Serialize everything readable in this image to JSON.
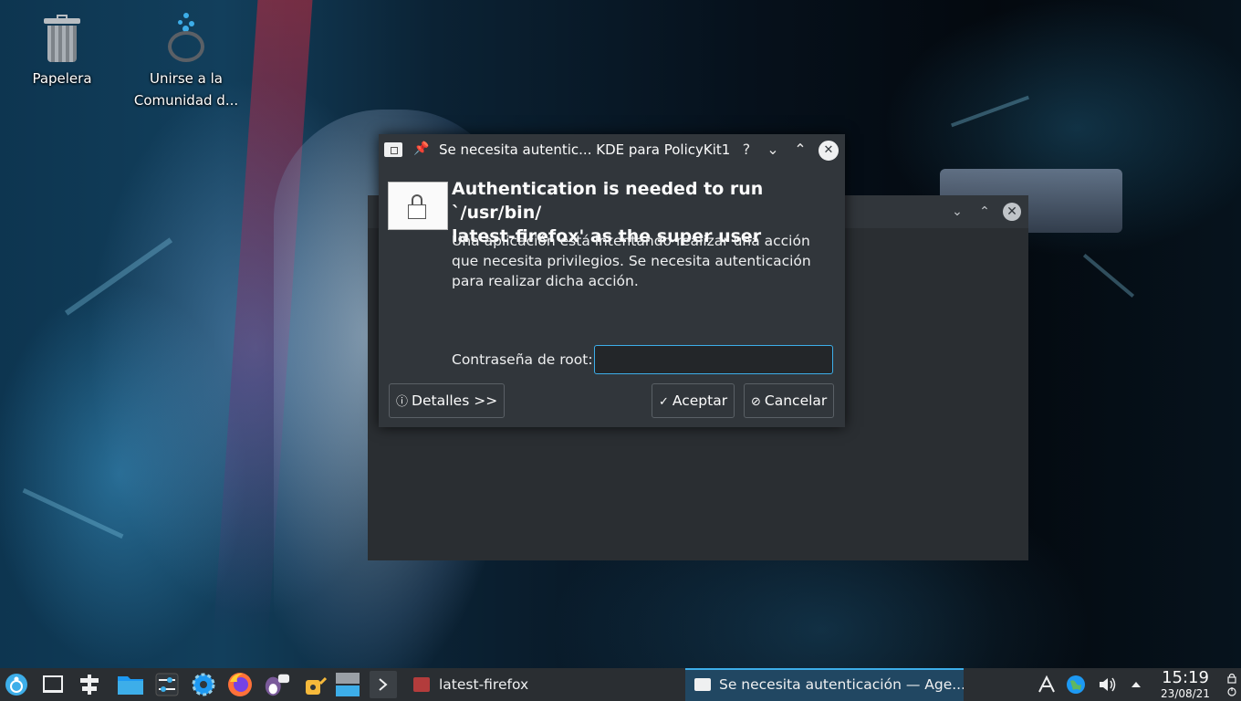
{
  "desktop": {
    "icons": [
      {
        "label": "Papelera",
        "icon": "trash-icon"
      },
      {
        "label": "Unirse a la Comunidad d...",
        "icon": "community-icon"
      }
    ]
  },
  "background_window": {
    "controls": [
      "minimize",
      "maximize",
      "close"
    ]
  },
  "dialog": {
    "title": "Se necesita autentic... KDE para PolicyKit1",
    "heading": "Authentication is needed to run `/usr/bin/latest-firefox' as the super user",
    "heading_line1": "Authentication is needed to run `/usr/bin/",
    "heading_line2": "latest-firefox' as the super user",
    "description": "Una aplicación está intentando realizar una acción que necesita privilegios. Se necesita autenticación para realizar dicha acción.",
    "password_label": "Contraseña de root:",
    "password_value": "",
    "details_button": "Detalles >>",
    "ok_button": "Aceptar",
    "cancel_button": "Cancelar",
    "title_controls": {
      "help": "?",
      "minimize": "⌄",
      "maximize": "⌃"
    }
  },
  "taskbar": {
    "launchers": [
      "application-menu-icon",
      "show-desktop-icon",
      "pager-icon",
      "file-manager-icon",
      "system-settings-icon",
      "settings-gear-icon",
      "firefox-icon",
      "chat-icon",
      "watering-can-icon",
      "window-list-icon",
      "terminal-icon"
    ],
    "tasks": [
      {
        "label": "latest-firefox",
        "active": false
      },
      {
        "label": "Se necesita autenticación — Age...",
        "active": true
      }
    ],
    "tray": [
      "kde-connect-icon",
      "network-globe-icon",
      "volume-icon",
      "expand-tray-icon"
    ],
    "clock": {
      "time": "15:19",
      "date": "23/08/21"
    }
  },
  "colors": {
    "accent": "#3daee9",
    "window_bg": "#31363b",
    "taskbar_bg": "#2a2e32",
    "active_task": "#214762"
  }
}
